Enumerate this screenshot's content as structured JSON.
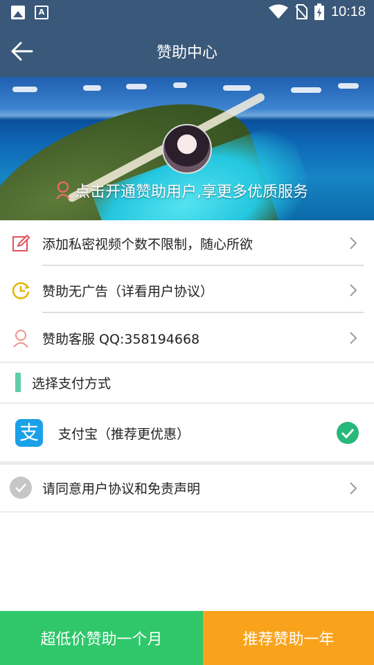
{
  "status_bar": {
    "time": "10:18",
    "left_icons": [
      "image-icon",
      "text-a-icon"
    ],
    "right_icons": [
      "wifi-icon",
      "no-sim-icon",
      "battery-charging-icon"
    ]
  },
  "header": {
    "title": "赞助中心",
    "back_icon": "arrow-left-icon"
  },
  "banner": {
    "promo_text": "点击开通赞助用户,享更多优质服务"
  },
  "benefits": [
    {
      "icon": "edit-icon",
      "label": "添加私密视频个数不限制，随心所欲"
    },
    {
      "icon": "clock-icon",
      "label": "赞助无广告（详看用户协议）"
    },
    {
      "icon": "user-service-icon",
      "label": "赞助客服 QQ:358194668"
    }
  ],
  "payment": {
    "section_title": "选择支付方式",
    "method_label": "支付宝（推荐更优惠）",
    "method_icon": "alipay-icon",
    "selected": true
  },
  "agreement": {
    "label": "请同意用户协议和免责声明",
    "checked": false
  },
  "buttons": {
    "month": "超低价赞助一个月",
    "year": "推荐赞助一年"
  },
  "colors": {
    "header_bg": "#3a5879",
    "accent_green": "#2fc76a",
    "accent_orange": "#f9a31c",
    "section_bar": "#5ecfa5",
    "alipay_blue": "#1aa0e8"
  }
}
